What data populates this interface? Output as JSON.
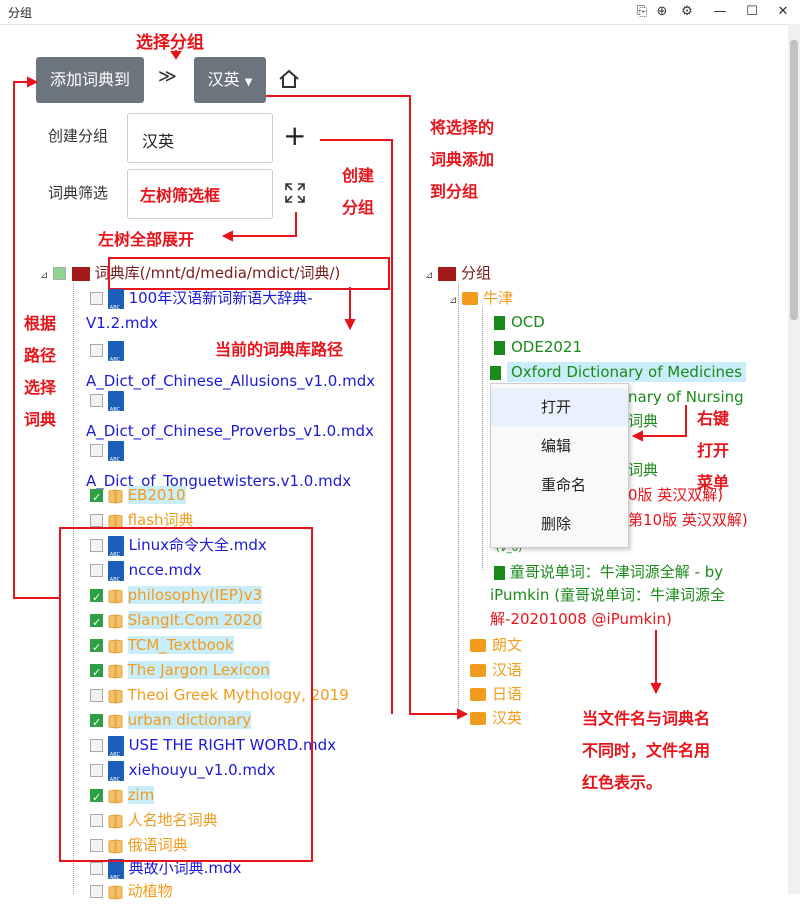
{
  "window": {
    "title": "分组"
  },
  "toolbar": {
    "add_label": "添加词典到",
    "group_select": "汉英"
  },
  "form": {
    "create_group_label": "创建分组",
    "create_group_value": "汉英",
    "filter_label": "词典筛选"
  },
  "annotations": {
    "select_group": "选择分组",
    "add_to_group": [
      "将选择的",
      "词典添加",
      "到分组"
    ],
    "create_group": [
      "创建",
      "分组"
    ],
    "left_filter": "左树筛选框",
    "expand_all": "左树全部展开",
    "current_path": "当前的词典库路径",
    "by_path": [
      "根据",
      "路径",
      "选择",
      "词典"
    ],
    "right_menu": [
      "右键",
      "打开",
      "菜单"
    ],
    "red_note": [
      "当文件名与词典名",
      "不同时，文件名用",
      "红色表示。"
    ]
  },
  "left_tree": {
    "root": "词典库(/mnt/d/media/mdict/词典/)",
    "items": [
      {
        "text": "100年汉语新词新语大辞典-",
        "text2": "V1.2.mdx",
        "kind": "file",
        "checked": false
      },
      {
        "text": "A_Dict_of_Chinese_Allusions_v1.0.mdx",
        "kind": "file",
        "checked": false
      },
      {
        "text": "A_Dict_of_Chinese_Proverbs_v1.0.mdx",
        "kind": "file",
        "checked": false
      },
      {
        "text": "A_Dict_of_Tonguetwisters.v1.0.mdx",
        "kind": "file",
        "checked": false
      },
      {
        "text": "EB2010",
        "kind": "folder",
        "checked": true
      },
      {
        "text": "flash词典",
        "kind": "folder",
        "checked": false
      },
      {
        "text": "Linux命令大全.mdx",
        "kind": "file",
        "checked": false
      },
      {
        "text": "ncce.mdx",
        "kind": "file",
        "checked": false
      },
      {
        "text": "philosophy(IEP)v3",
        "kind": "folder",
        "checked": true
      },
      {
        "text": "SlangIt.Com 2020",
        "kind": "folder",
        "checked": true
      },
      {
        "text": "TCM_Textbook",
        "kind": "folder",
        "checked": true
      },
      {
        "text": "The Jargon Lexicon",
        "kind": "folder",
        "checked": true
      },
      {
        "text": "Theoi Greek Mythology, 2019",
        "kind": "folder",
        "checked": false
      },
      {
        "text": "urban dictionary",
        "kind": "folder",
        "checked": true
      },
      {
        "text": "USE THE RIGHT WORD.mdx",
        "kind": "file",
        "checked": false
      },
      {
        "text": "xiehouyu_v1.0.mdx",
        "kind": "file",
        "checked": false
      },
      {
        "text": "zim",
        "kind": "folder",
        "checked": true
      },
      {
        "text": "人名地名词典",
        "kind": "folder",
        "checked": false
      },
      {
        "text": "俄语词典",
        "kind": "folder",
        "checked": false
      },
      {
        "text": "典故小词典.mdx",
        "kind": "file",
        "checked": false
      },
      {
        "text": "动植物",
        "kind": "folder",
        "checked": false
      }
    ]
  },
  "right_tree": {
    "root": "分组",
    "group_niujin": "牛津",
    "children": [
      "OCD",
      "ODE2021",
      "Oxford Dictionary of Medicines",
      "nary of Nursing",
      "词典",
      "词典",
      "0版 英汉双解)",
      "第10版 英汉双解)",
      "(V_0)"
    ],
    "tongge": [
      "童哥说单词：牛津词源全解 - by",
      "iPumkin (童哥说单词：牛津词源全",
      "解-20201008 @iPumkin)"
    ],
    "groups": [
      "朗文",
      "汉语",
      "日语",
      "汉英"
    ]
  },
  "context_menu": {
    "items": [
      "打开",
      "编辑",
      "重命名",
      "删除"
    ]
  },
  "colors": {
    "accent_red": "#e8141b",
    "button_gray": "#6c757d",
    "blue_file": "#1a1ad6",
    "orange_folder": "#f29b1d",
    "green_dict": "#1a8a1a",
    "highlight": "#c9eef9"
  }
}
